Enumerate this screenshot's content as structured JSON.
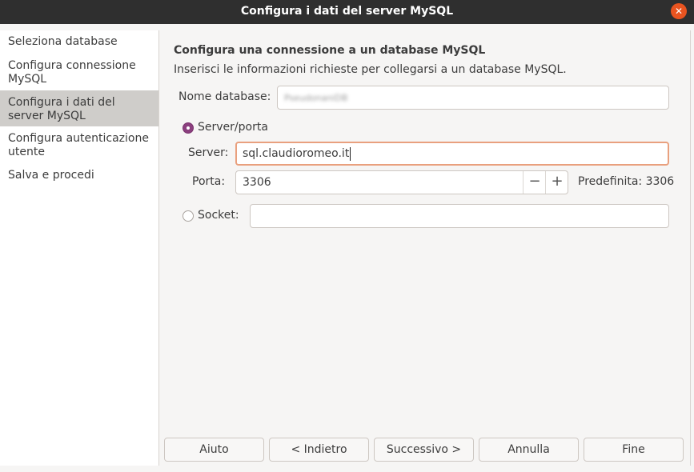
{
  "window": {
    "title": "Configura i dati del server MySQL",
    "close_glyph": "✕"
  },
  "sidebar": {
    "items": [
      {
        "label": "Seleziona database"
      },
      {
        "label": "Configura connessione MySQL"
      },
      {
        "label": "Configura i dati del server MySQL"
      },
      {
        "label": "Configura autenticazione utente"
      },
      {
        "label": "Salva e procedi"
      }
    ],
    "active_index": 2
  },
  "main": {
    "heading": "Configura una connessione a un database MySQL",
    "subheading": "Inserisci le informazioni richieste per collegarsi a un database MySQL.",
    "database_name": {
      "label": "Nome database:",
      "value": "PseudonaniDB"
    },
    "server_port_option": {
      "label": "Server/porta",
      "selected": true
    },
    "server": {
      "label": "Server:",
      "value": "sql.claudioromeo.it"
    },
    "port": {
      "label": "Porta:",
      "value": "3306",
      "decrement": "−",
      "increment": "+",
      "default_text": "Predefinita: 3306"
    },
    "socket_option": {
      "label": "Socket:",
      "selected": false,
      "value": ""
    }
  },
  "buttons": {
    "help": "Aiuto",
    "back": "< Indietro",
    "next": "Successivo >",
    "cancel": "Annulla",
    "finish": "Fine"
  },
  "colors": {
    "accent": "#e95420",
    "radio_selected": "#8b3f7e",
    "focus_border": "#e9a07e",
    "titlebar": "#2f2f2f"
  }
}
